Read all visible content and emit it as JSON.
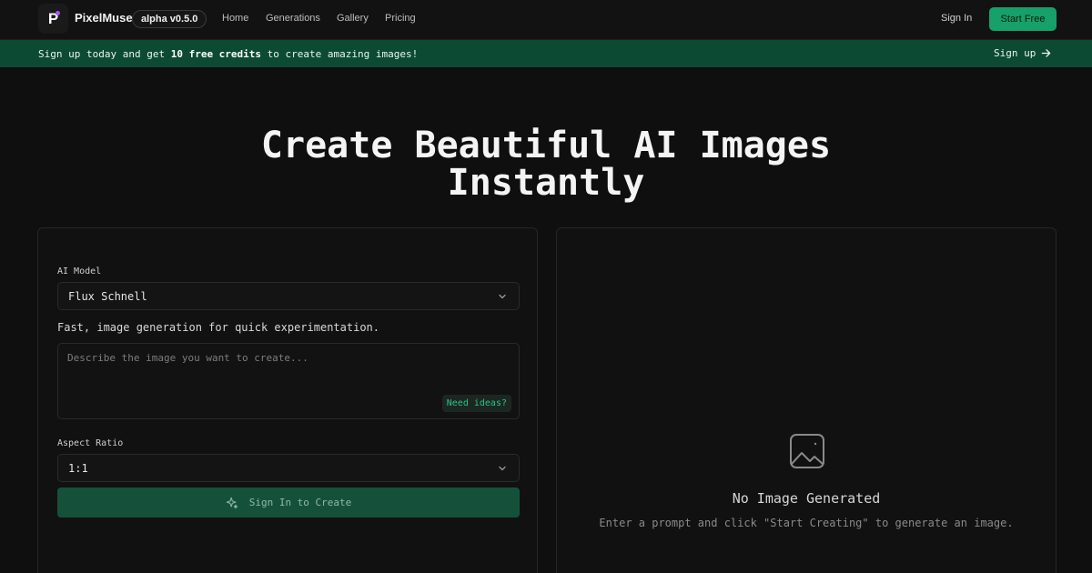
{
  "nav": {
    "logo_letter": "P",
    "brand": "PixelMuse",
    "version": "alpha v0.5.0",
    "links": [
      "Home",
      "Generations",
      "Gallery",
      "Pricing"
    ],
    "sign_in": "Sign In",
    "start_free": "Start Free"
  },
  "banner": {
    "text_before": "Sign up today and get ",
    "text_bold": "10 free credits",
    "text_after": " to create amazing images!",
    "cta": "Sign up",
    "cta_icon": "arrow-right-icon"
  },
  "hero": {
    "line1": "Create Beautiful AI Images",
    "line2": "Instantly"
  },
  "form": {
    "model_label": "AI Model",
    "model_value": "Flux Schnell",
    "model_description": "Fast, image generation for quick experimentation.",
    "prompt_placeholder": "Describe the image you want to create...",
    "need_ideas": "Need ideas?",
    "aspect_label": "Aspect Ratio",
    "aspect_value": "1:1",
    "create_button": "Sign In to Create",
    "create_icon": "sparkles-icon"
  },
  "preview": {
    "icon": "image-icon",
    "title": "No Image Generated",
    "subtitle": "Enter a prompt and click \"Start Creating\" to generate an image."
  },
  "colors": {
    "accent": "#16a06a",
    "banner_bg": "#0c4a33",
    "button_bg": "#15513a",
    "page_bg": "#0f0f0f"
  }
}
